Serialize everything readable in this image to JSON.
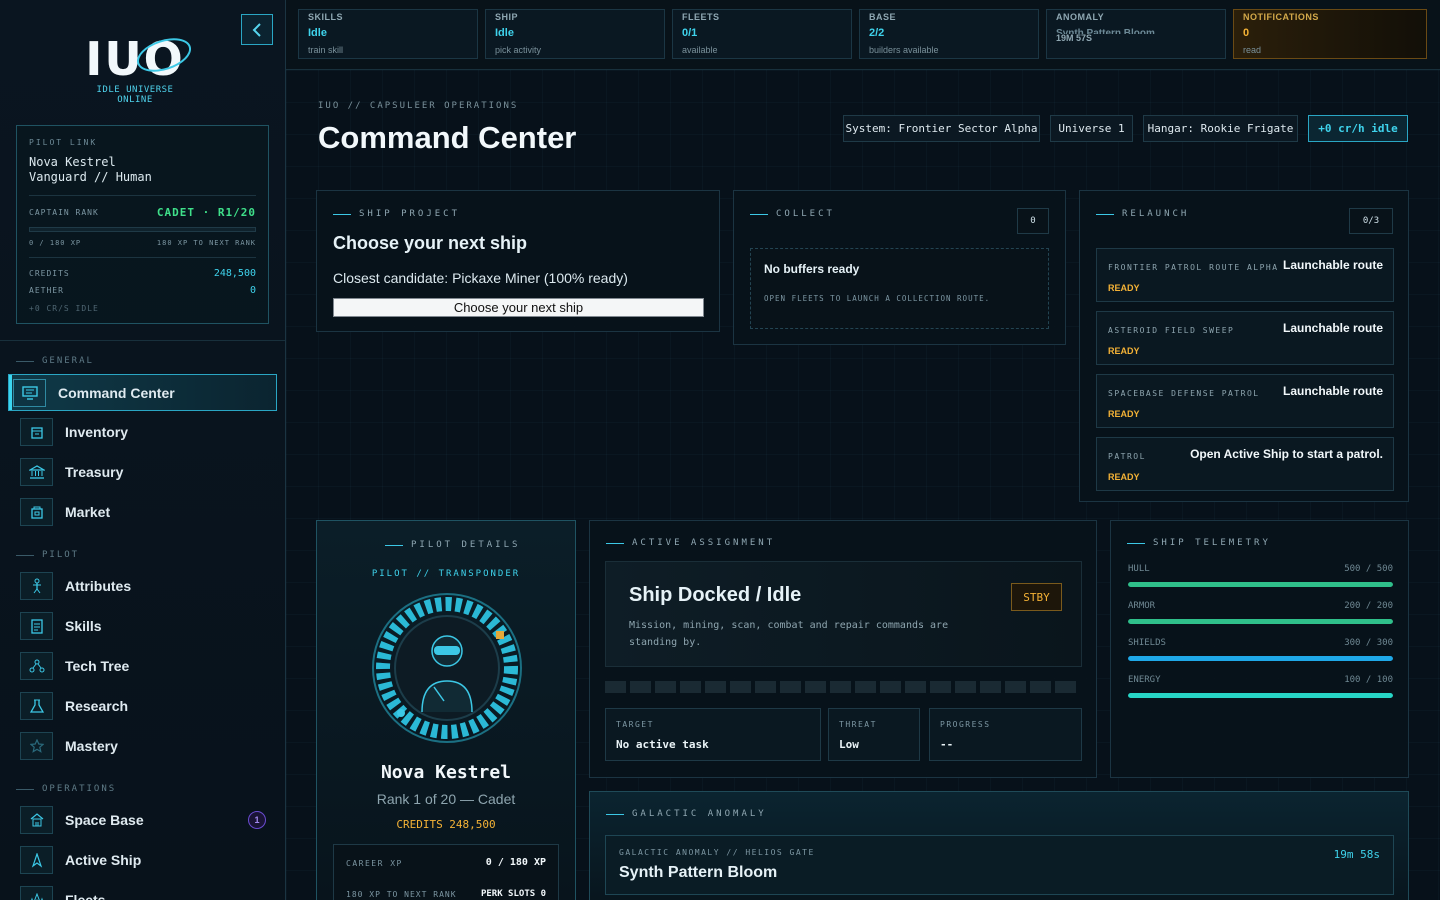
{
  "brand": {
    "logo": "IUO",
    "tagline": "IDLE UNIVERSE ONLINE"
  },
  "pilot_card": {
    "label": "PILOT LINK",
    "name": "Nova Kestrel",
    "subtitle": "Vanguard // Human",
    "rank_label": "CAPTAIN RANK",
    "rank_value": "CADET · R1/20",
    "xp": "0 / 180 XP",
    "xp_next": "180 XP TO NEXT RANK",
    "xp_progress": 0,
    "credits_label": "CREDITS",
    "credits_value": "248,500",
    "aether_label": "AETHER",
    "aether_value": "0",
    "idle_rate": "+0 CR/S IDLE"
  },
  "nav": {
    "general_label": "GENERAL",
    "pilot_label": "PILOT",
    "operations_label": "OPERATIONS",
    "items": [
      {
        "label": "Command Center",
        "icon": "monitor-icon"
      },
      {
        "label": "Inventory",
        "icon": "box-icon"
      },
      {
        "label": "Treasury",
        "icon": "bank-icon"
      },
      {
        "label": "Market",
        "icon": "store-icon"
      },
      {
        "label": "Attributes",
        "icon": "figure-icon"
      },
      {
        "label": "Skills",
        "icon": "document-icon"
      },
      {
        "label": "Tech Tree",
        "icon": "nodes-icon"
      },
      {
        "label": "Research",
        "icon": "flask-icon"
      },
      {
        "label": "Mastery",
        "icon": "star-icon"
      },
      {
        "label": "Space Base",
        "icon": "base-icon",
        "badge": "1"
      },
      {
        "label": "Active Ship",
        "icon": "ship-icon"
      },
      {
        "label": "Fleets",
        "icon": "fleet-icon"
      }
    ]
  },
  "topbar": [
    {
      "label": "SKILLS",
      "value": "Idle",
      "sub": "train skill"
    },
    {
      "label": "SHIP",
      "value": "Idle",
      "sub": "pick activity"
    },
    {
      "label": "FLEETS",
      "value": "0/1",
      "sub": "available"
    },
    {
      "label": "BASE",
      "value": "2/2",
      "sub": "builders available"
    },
    {
      "label": "ANOMALY",
      "value": "Synth Pattern Bloom",
      "sub": "19M 57S"
    },
    {
      "label": "NOTIFICATIONS",
      "value": "0",
      "sub": "read"
    }
  ],
  "header": {
    "breadcrumb": "IUO // CAPSULEER OPERATIONS",
    "title": "Command Center",
    "chips": [
      "System: Frontier Sector Alpha",
      "Universe 1",
      "Hangar: Rookie Frigate",
      "+0 cr/h idle"
    ]
  },
  "ship_project": {
    "head": "SHIP PROJECT",
    "title": "Choose your next ship",
    "candidate": "Closest candidate: Pickaxe Miner (100% ready)",
    "button": "Choose your next ship"
  },
  "collect": {
    "head": "COLLECT",
    "count": "0",
    "empty_title": "No buffers ready",
    "empty_sub": "OPEN FLEETS TO LAUNCH A COLLECTION ROUTE."
  },
  "relaunch": {
    "head": "RELAUNCH",
    "count": "0/3",
    "routes": [
      {
        "name": "FRONTIER PATROL ROUTE ALPHA",
        "status": "READY",
        "action": "Launchable route"
      },
      {
        "name": "ASTEROID FIELD SWEEP",
        "status": "READY",
        "action": "Launchable route"
      },
      {
        "name": "SPACEBASE DEFENSE PATROL",
        "status": "READY",
        "action": "Launchable route"
      },
      {
        "name": "PATROL",
        "status": "READY",
        "action": "Open Active Ship to start a patrol."
      }
    ]
  },
  "pilot_details": {
    "head": "PILOT DETAILS",
    "sub": "PILOT // TRANSPONDER",
    "name": "Nova Kestrel",
    "rank": "Rank 1 of 20 — Cadet",
    "credits": "CREDITS 248,500",
    "career_label": "CAREER XP",
    "career_value": "0 / 180 XP",
    "next_rank": "180 XP TO NEXT RANK",
    "perk_slots": "PERK SLOTS 0"
  },
  "assignment": {
    "head": "ACTIVE ASSIGNMENT",
    "title": "Ship Docked / Idle",
    "badge": "STBY",
    "desc": "Mission, mining, scan, combat and repair commands are standing by.",
    "target_label": "TARGET",
    "target_value": "No active task",
    "threat_label": "THREAT",
    "threat_value": "Low",
    "progress_label": "PROGRESS",
    "progress_value": "--"
  },
  "telemetry": {
    "head": "SHIP TELEMETRY",
    "rows": [
      {
        "label": "HULL",
        "value": "500 / 500",
        "level": 1.0,
        "color": "#2fbf8a"
      },
      {
        "label": "ARMOR",
        "value": "200 / 200",
        "level": 1.0,
        "color": "#2fbf8a"
      },
      {
        "label": "SHIELDS",
        "value": "300 / 300",
        "level": 1.0,
        "color": "#1fa8e8"
      },
      {
        "label": "ENERGY",
        "value": "100 / 100",
        "level": 1.0,
        "color": "#27d6c6"
      }
    ]
  },
  "anomaly": {
    "head": "GALACTIC ANOMALY",
    "location": "GALACTIC ANOMALY // HELIOS GATE",
    "name": "Synth Pattern Bloom",
    "timer": "19m 58s"
  },
  "colors": {
    "accent": "#3cc8e6",
    "ready": "#f4b236",
    "rank": "#3fe08a",
    "background": "#060d14"
  }
}
